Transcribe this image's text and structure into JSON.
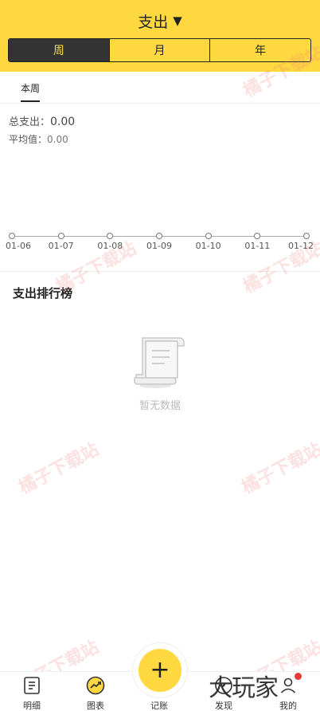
{
  "header": {
    "title": "支出",
    "caret": "▼",
    "segments": [
      "周",
      "月",
      "年"
    ],
    "active_segment": 0
  },
  "subtabs": {
    "current": "本周"
  },
  "summary": {
    "total_label": "总支出：",
    "total_value": "0.00",
    "avg_label": "平均值：",
    "avg_value": "0.00"
  },
  "chart_data": {
    "type": "line",
    "categories": [
      "01-06",
      "01-07",
      "01-08",
      "01-09",
      "01-10",
      "01-11",
      "01-12"
    ],
    "values": [
      0,
      0,
      0,
      0,
      0,
      0,
      0
    ],
    "title": "",
    "xlabel": "",
    "ylabel": ""
  },
  "ranking": {
    "title": "支出排行榜",
    "empty_text": "暂无数据"
  },
  "watermarks": [
    "橘子下载站",
    "橘子下载站",
    "橘子下载站",
    "橘子下载站",
    "橘子下载站",
    "橘子下载站",
    "橘子下载站"
  ],
  "tabbar": {
    "items": [
      {
        "label": "明细",
        "icon": "list-icon"
      },
      {
        "label": "图表",
        "icon": "chart-icon"
      },
      {
        "label": "记账",
        "icon": "plus-icon"
      },
      {
        "label": "发现",
        "icon": "discover-icon"
      },
      {
        "label": "我的",
        "icon": "profile-icon"
      }
    ],
    "fab_symbol": "+",
    "brand_overlay": "大玩家"
  },
  "colors": {
    "accent": "#ffd93f",
    "dark": "#333333",
    "badge": "#e53935"
  }
}
